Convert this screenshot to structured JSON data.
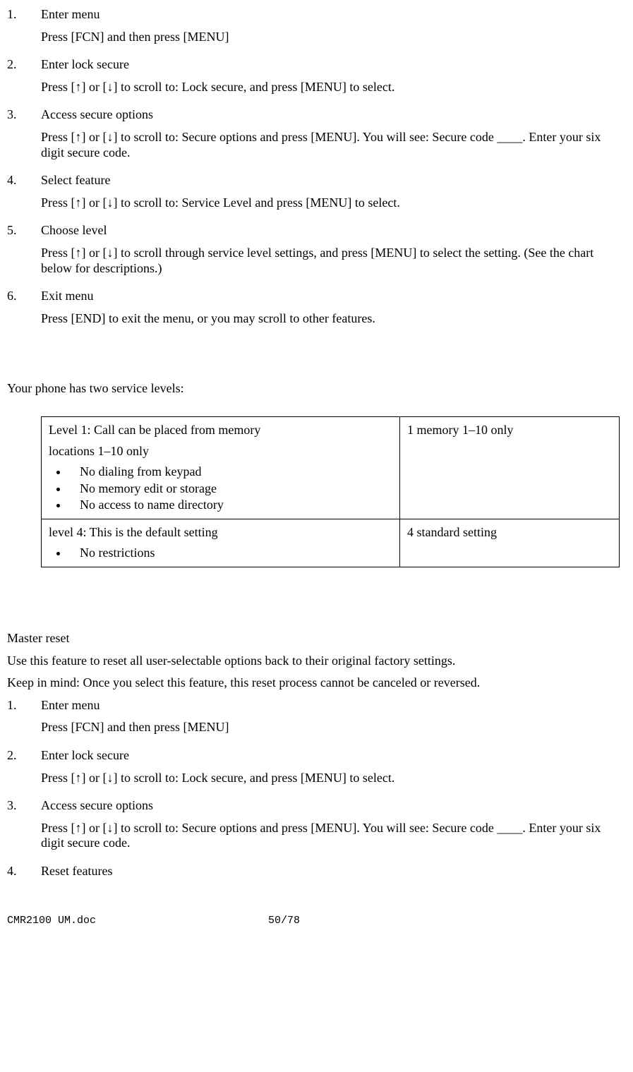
{
  "steps_a": [
    {
      "num": "1.",
      "title": "Enter menu",
      "desc": "Press [FCN] and then press [MENU]"
    },
    {
      "num": "2.",
      "title": "Enter lock secure",
      "desc": "Press [↑] or [↓] to scroll to: Lock secure, and press [MENU] to select."
    },
    {
      "num": "3.",
      "title": "Access secure options",
      "desc": "Press [↑] or [↓] to scroll to: Secure options and press [MENU]. You will see: Secure code ____. Enter your six digit secure code."
    },
    {
      "num": "4.",
      "title": "Select feature",
      "desc": "Press [↑] or [↓] to scroll to: Service Level and press [MENU] to select."
    },
    {
      "num": "5.",
      "title": "Choose level",
      "desc": "Press [↑] or [↓] to scroll through service level settings, and press [MENU] to select the setting. (See the chart below for descriptions.)"
    },
    {
      "num": "6.",
      "title": "Exit menu",
      "desc": "Press [END] to exit the menu, or you may scroll to other features."
    }
  ],
  "levels_intro": "Your phone has two service levels:",
  "table": {
    "row1": {
      "left_line1": "Level 1: Call can be placed from memory",
      "left_line2": "locations 1–10 only",
      "bullets": [
        "No dialing from keypad",
        "No memory edit or storage",
        "No access to name directory"
      ],
      "right": "1 memory 1–10 only"
    },
    "row2": {
      "left_line1": "level 4: This is the default setting",
      "bullets": [
        "No restrictions"
      ],
      "right": "4 standard setting"
    }
  },
  "master_reset": {
    "heading": "Master reset",
    "p1": "Use this feature to reset all user-selectable options back to their original factory settings.",
    "p2": "Keep in mind: Once you select this feature, this reset process cannot be canceled or reversed."
  },
  "steps_b": [
    {
      "num": "1.",
      "title": "Enter menu",
      "desc": "Press [FCN] and then press [MENU]"
    },
    {
      "num": "2.",
      "title": "Enter lock secure",
      "desc": "Press [↑] or [↓] to scroll to: Lock secure, and press [MENU] to select."
    },
    {
      "num": "3.",
      "title": "Access secure options",
      "desc": "Press [↑] or [↓] to scroll to: Secure options and press [MENU]. You will see: Secure code ____. Enter your six digit secure code."
    },
    {
      "num": "4.",
      "title": "Reset features",
      "desc": ""
    }
  ],
  "footer": {
    "left": "CMR2100 UM.doc",
    "center": "50/78"
  }
}
